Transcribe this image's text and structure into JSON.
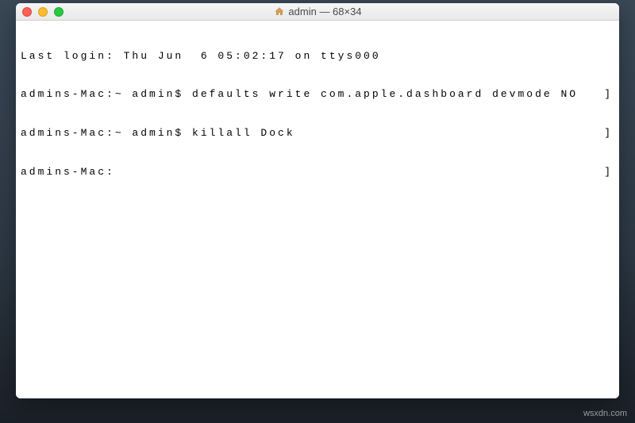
{
  "window": {
    "title": "admin — 68×34",
    "home_icon": "home-icon"
  },
  "terminal": {
    "lines": [
      {
        "left": "Last login: Thu Jun  6 05:02:17 on ttys000",
        "right": ""
      },
      {
        "left": "admins-Mac:~ admin$ defaults write com.apple.dashboard devmode NO",
        "right": "]"
      },
      {
        "left": "admins-Mac:~ admin$ killall Dock",
        "right": "]"
      },
      {
        "left": "admins-Mac:",
        "right": "]"
      }
    ]
  },
  "watermark": "wsxdn.com"
}
